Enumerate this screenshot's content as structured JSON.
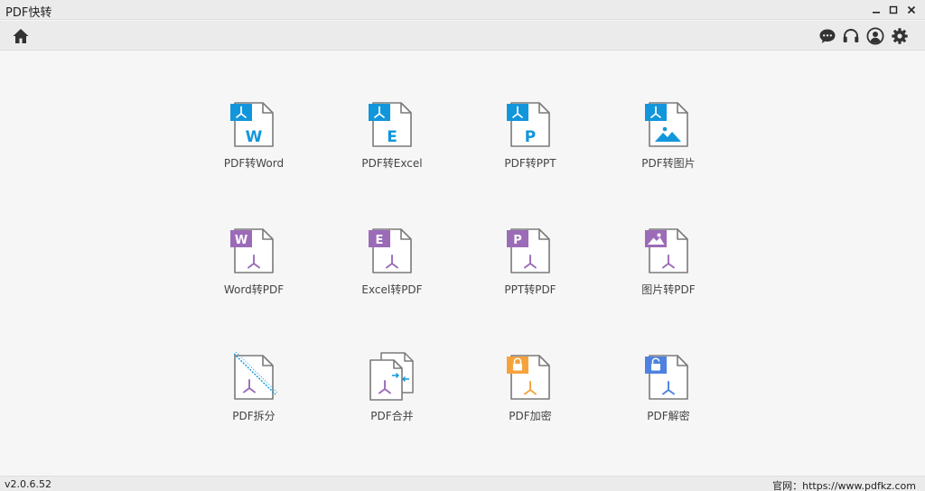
{
  "window": {
    "title": "PDF快转"
  },
  "icons": {
    "minimize": "minimize-icon",
    "maximize": "maximize-icon",
    "close": "close-icon",
    "home": "home-icon",
    "chat": "chat-bubble-icon",
    "support": "headset-icon",
    "user": "user-avatar-icon",
    "settings": "gear-icon"
  },
  "colors": {
    "blue": "#1296db",
    "purple": "#9b6bb8",
    "orange": "#f6a33c",
    "lock_blue": "#4e82e0",
    "pdf_red": "#c55070",
    "outline": "#7a7a7a"
  },
  "tools": [
    {
      "label": "PDF转Word",
      "letter": "W"
    },
    {
      "label": "PDF转Excel",
      "letter": "E"
    },
    {
      "label": "PDF转PPT",
      "letter": "P"
    },
    {
      "label": "PDF转图片",
      "letter": ""
    },
    {
      "label": "Word转PDF",
      "letter": "W"
    },
    {
      "label": "Excel转PDF",
      "letter": "E"
    },
    {
      "label": "PPT转PDF",
      "letter": "P"
    },
    {
      "label": "图片转PDF",
      "letter": ""
    },
    {
      "label": "PDF拆分",
      "letter": ""
    },
    {
      "label": "PDF合并",
      "letter": ""
    },
    {
      "label": "PDF加密",
      "letter": ""
    },
    {
      "label": "PDF解密",
      "letter": ""
    }
  ],
  "status": {
    "version": "v2.0.6.52",
    "website": "官网：https://www.pdfkz.com"
  }
}
